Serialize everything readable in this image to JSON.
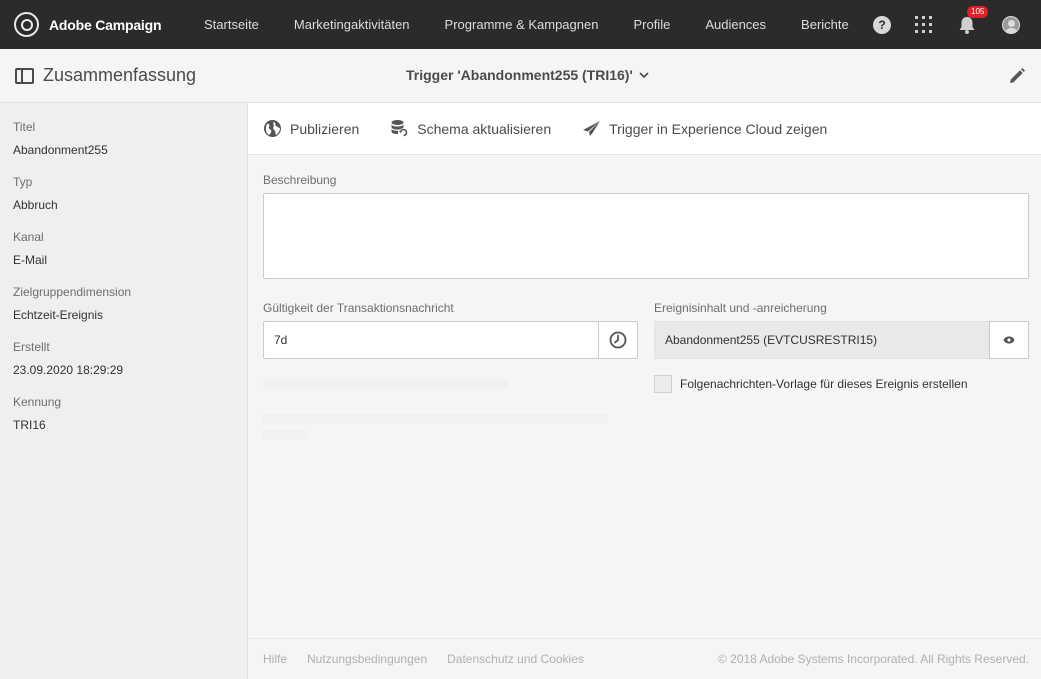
{
  "app": {
    "brand": "Adobe Campaign",
    "brand_icon": "adobe-campaign-logo"
  },
  "nav": {
    "items": [
      "Startseite",
      "Marketingaktivitäten",
      "Programme & Kampagnen",
      "Profile",
      "Audiences",
      "Berichte"
    ],
    "help_glyph": "?",
    "notification_count": "105"
  },
  "header": {
    "summary_label": "Zusammenfassung",
    "trigger_title": "Trigger 'Abandonment255 (TRI16)'",
    "chevron": "⌄"
  },
  "sidebar": {
    "fields": [
      {
        "label": "Titel",
        "value": "Abandonment255"
      },
      {
        "label": "Typ",
        "value": "Abbruch"
      },
      {
        "label": "Kanal",
        "value": "E-Mail"
      },
      {
        "label": "Zielgruppendimension",
        "value": "Echtzeit-Ereignis"
      },
      {
        "label": "Erstellt",
        "value": "23.09.2020 18:29:29"
      },
      {
        "label": "Kennung",
        "value": "TRI16"
      }
    ]
  },
  "toolbar": {
    "publish": "Publizieren",
    "update_schema": "Schema aktualisieren",
    "show_in_cloud": "Trigger in Experience Cloud zeigen"
  },
  "form": {
    "description_label": "Beschreibung",
    "description_value": "",
    "validity_label": "Gültigkeit der Transaktionsnachricht",
    "validity_value": "7d",
    "event_label": "Ereignisinhalt und -anreicherung",
    "event_value": "Abandonment255 (EVTCUSRESTRI15)",
    "followup_label": "Folgenachrichten-Vorlage für dieses Ereignis erstellen",
    "followup_checked": false
  },
  "footer": {
    "help": "Hilfe",
    "terms": "Nutzungsbedingungen",
    "privacy": "Datenschutz und Cookies",
    "copyright": "© 2018 Adobe Systems Incorporated. All Rights Reserved."
  },
  "colors": {
    "topbar": "#2b2b2b",
    "badge": "#e31e25",
    "sidebar_bg": "#efefef",
    "content_bg": "#f5f5f5"
  }
}
